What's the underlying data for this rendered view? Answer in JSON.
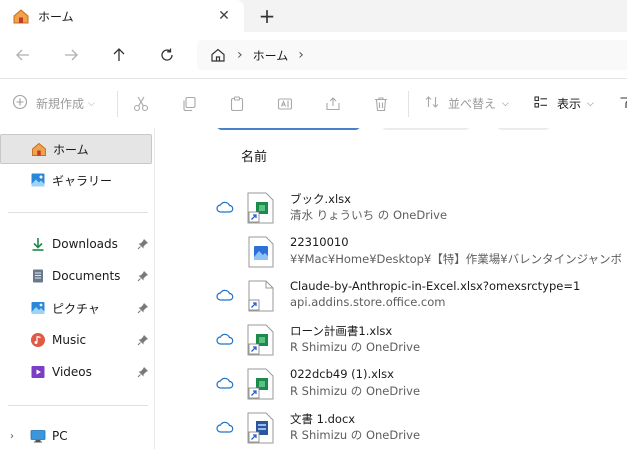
{
  "tab": {
    "title": "ホーム",
    "close": "✕",
    "new": "+"
  },
  "address": {
    "crumb": "ホーム",
    "sep": "›",
    "trail": "›"
  },
  "toolbar": {
    "new_label": "新規作成",
    "sort_label": "並べ替え",
    "view_label": "表示",
    "dropdown": "⌵"
  },
  "sidebar": {
    "top": [
      {
        "label": "ホーム",
        "icon": "home-icon",
        "selected": true
      },
      {
        "label": "ギャラリー",
        "icon": "gallery-icon"
      }
    ],
    "quick": [
      {
        "label": "Downloads",
        "icon": "download-icon"
      },
      {
        "label": "Documents",
        "icon": "documents-icon"
      },
      {
        "label": "ピクチャ",
        "icon": "pictures-icon"
      },
      {
        "label": "Music",
        "icon": "music-icon"
      },
      {
        "label": "Videos",
        "icon": "videos-icon"
      }
    ],
    "pc": {
      "label": "PC",
      "expand": "›"
    }
  },
  "main": {
    "column_header": "名前",
    "files": [
      {
        "name": "ブック.xlsx",
        "location": "清水 りょういち の OneDrive",
        "type": "excel",
        "cloud": true
      },
      {
        "name": "22310010",
        "location": "¥¥Mac¥Home¥Desktop¥【特】作業場¥バレンタインジャンボ",
        "type": "image",
        "cloud": false
      },
      {
        "name": "Claude-by-Anthropic-in-Excel.xlsx?omexsrctype=1",
        "location": "api.addins.store.office.com",
        "type": "generic",
        "cloud": true
      },
      {
        "name": "ローン計画書1.xlsx",
        "location": "R Shimizu の OneDrive",
        "type": "excel",
        "cloud": true
      },
      {
        "name": "022dcb49 (1).xlsx",
        "location": "R Shimizu の OneDrive",
        "type": "excel",
        "cloud": true
      },
      {
        "name": "文書 1.docx",
        "location": "R Shimizu の OneDrive",
        "type": "word",
        "cloud": true
      }
    ]
  },
  "colors": {
    "accent": "#0067c0",
    "excel": "#107c41",
    "word": "#2b579a",
    "selected_bg": "#e5e5e5"
  }
}
